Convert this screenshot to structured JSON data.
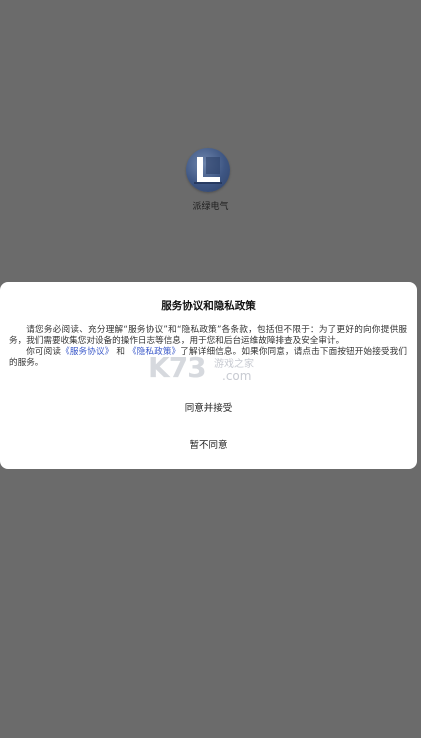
{
  "app": {
    "name": "派绿电气",
    "logo_icon": "app-logo-icon"
  },
  "dialog": {
    "title": "服务协议和隐私政策",
    "para1": "请您务必阅读、充分理解“服务协议”和“隐私政策”各条款，包括但不限于：为了更好的向你提供服务，我们需要收集您对设备的操作日志等信息，用于您和后台运维故障排查及安全审计。",
    "para2_prefix": "你可阅读",
    "service_link": "《服务协议》",
    "para2_and": "和",
    "privacy_link": "《隐私政策》",
    "para2_suffix": "了解详细信息。如果你同意，请点击下面按钮开始接受我们的服务。",
    "agree_label": "同意并接受",
    "disagree_label": "暂不同意"
  },
  "watermark": {
    "big": "K73",
    "small": "游戏之家",
    "com": ".com"
  },
  "colors": {
    "overlay": "#6b6b6b",
    "link": "#3a58c9",
    "dialog_bg": "#ffffff"
  }
}
